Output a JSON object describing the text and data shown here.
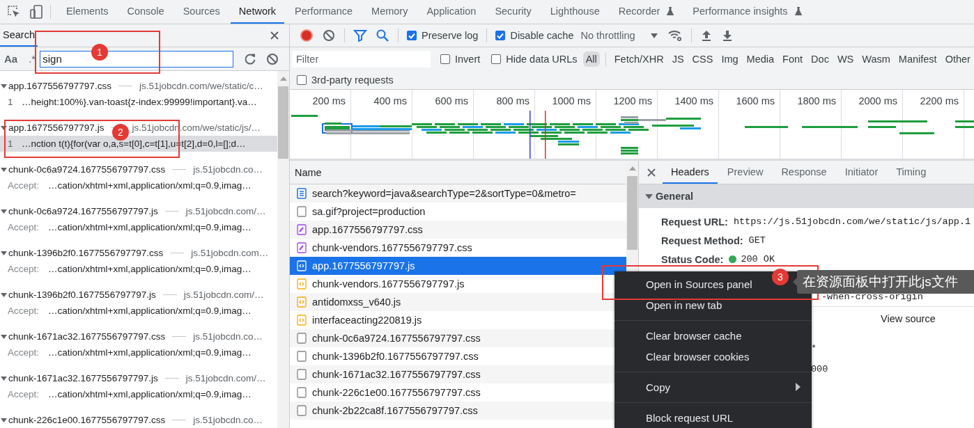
{
  "top_tabs": [
    {
      "label": "Elements",
      "selected": false,
      "experimental": false
    },
    {
      "label": "Console",
      "selected": false,
      "experimental": false
    },
    {
      "label": "Sources",
      "selected": false,
      "experimental": false
    },
    {
      "label": "Network",
      "selected": true,
      "experimental": false
    },
    {
      "label": "Performance",
      "selected": false,
      "experimental": false
    },
    {
      "label": "Memory",
      "selected": false,
      "experimental": false
    },
    {
      "label": "Application",
      "selected": false,
      "experimental": false
    },
    {
      "label": "Security",
      "selected": false,
      "experimental": false
    },
    {
      "label": "Lighthouse",
      "selected": false,
      "experimental": false
    },
    {
      "label": "Recorder",
      "selected": false,
      "experimental": true
    },
    {
      "label": "Performance insights",
      "selected": false,
      "experimental": true
    }
  ],
  "search_panel": {
    "title": "Search",
    "case_toggle": "Aa",
    "regex_toggle": ".*",
    "query": "sign",
    "results": [
      {
        "file": "app.1677556797797.css",
        "url": "js.51jobcdn.com/we/static/c…",
        "expanded": true,
        "matches": [
          {
            "prefix": "1",
            "kind": "line",
            "text": "…height:100%}.van-toast{z-index:99999!important}.va…",
            "selected": false
          }
        ]
      },
      {
        "file": "app.1677556797797.js",
        "url": "js.51jobcdn.com/we/static/js/…",
        "expanded": true,
        "matches": [
          {
            "prefix": "1",
            "kind": "line",
            "text": "…nction t(t){for(var o,a,s=t[0],c=t[1],u=t[2],d=0,l=[];d…",
            "selected": true
          }
        ]
      },
      {
        "file": "chunk-0c6a9724.1677556797797.css",
        "url": "js.51jobcdn.co…",
        "expanded": true,
        "matches": [
          {
            "prefix": "Accept:",
            "kind": "header",
            "text": "…cation/xhtml+xml,application/xml;q=0.9,imag…",
            "selected": false
          }
        ]
      },
      {
        "file": "chunk-0c6a9724.1677556797797.js",
        "url": "js.51jobcdn.com/…",
        "expanded": true,
        "matches": [
          {
            "prefix": "Accept:",
            "kind": "header",
            "text": "…cation/xhtml+xml,application/xml;q=0.9,imag…",
            "selected": false
          }
        ]
      },
      {
        "file": "chunk-1396b2f0.1677556797797.css",
        "url": "js.51jobcdn.com…",
        "expanded": true,
        "matches": [
          {
            "prefix": "Accept:",
            "kind": "header",
            "text": "…cation/xhtml+xml,application/xml;q=0.9,imag…",
            "selected": false
          }
        ]
      },
      {
        "file": "chunk-1396b2f0.1677556797797.js",
        "url": "js.51jobcdn.com/…",
        "expanded": true,
        "matches": [
          {
            "prefix": "Accept:",
            "kind": "header",
            "text": "…cation/xhtml+xml,application/xml;q=0.9,imag…",
            "selected": false
          }
        ]
      },
      {
        "file": "chunk-1671ac32.1677556797797.css",
        "url": "js.51jobcdn.co…",
        "expanded": true,
        "matches": [
          {
            "prefix": "Accept:",
            "kind": "header",
            "text": "…cation/xhtml+xml,application/xml;q=0.9,imag…",
            "selected": false
          }
        ]
      },
      {
        "file": "chunk-1671ac32.1677556797797.js",
        "url": "js.51jobcdn.com/…",
        "expanded": true,
        "matches": [
          {
            "prefix": "Accept:",
            "kind": "header",
            "text": "…cation/xhtml+xml,application/xml;q=0.9,imag…",
            "selected": false
          }
        ]
      },
      {
        "file": "chunk-226c1e00.1677556797797.css",
        "url": "js.51jobcdn.co…",
        "expanded": true
      }
    ]
  },
  "network_toolbar": {
    "preserve_log": {
      "label": "Preserve log",
      "checked": true
    },
    "disable_cache": {
      "label": "Disable cache",
      "checked": true
    },
    "throttling": "No throttling"
  },
  "filter_bar": {
    "placeholder": "Filter",
    "invert": {
      "label": "Invert",
      "checked": false
    },
    "hide_data_urls": {
      "label": "Hide data URLs",
      "checked": false
    },
    "types": [
      {
        "label": "All",
        "selected": true
      },
      {
        "label": "Fetch/XHR",
        "selected": false
      },
      {
        "label": "JS",
        "selected": false
      },
      {
        "label": "CSS",
        "selected": false
      },
      {
        "label": "Img",
        "selected": false
      },
      {
        "label": "Media",
        "selected": false
      },
      {
        "label": "Font",
        "selected": false
      },
      {
        "label": "Doc",
        "selected": false
      },
      {
        "label": "WS",
        "selected": false
      },
      {
        "label": "Wasm",
        "selected": false
      },
      {
        "label": "Manifest",
        "selected": false
      },
      {
        "label": "Other",
        "selected": false
      }
    ],
    "third_party": {
      "label": "3rd-party requests",
      "checked": false
    }
  },
  "overview": {
    "ticks": [
      "200 ms",
      "400 ms",
      "600 ms",
      "800 ms",
      "1000 ms",
      "1200 ms",
      "1400 ms",
      "1600 ms",
      "1800 ms",
      "2000 ms",
      "2200 ms"
    ]
  },
  "requests": {
    "column": "Name",
    "rows": [
      {
        "name": "search?keyword=java&searchType=2&sortType=0&metro=",
        "kind": "document",
        "selected": false
      },
      {
        "name": "sa.gif?project=production",
        "kind": "other",
        "selected": false
      },
      {
        "name": "app.1677556797797.css",
        "kind": "stylesheet",
        "selected": false
      },
      {
        "name": "chunk-vendors.1677556797797.css",
        "kind": "stylesheet",
        "selected": false
      },
      {
        "name": "app.1677556797797.js",
        "kind": "script",
        "selected": true
      },
      {
        "name": "chunk-vendors.1677556797797.js",
        "kind": "script",
        "selected": false
      },
      {
        "name": "antidomxss_v640.js",
        "kind": "script",
        "selected": false
      },
      {
        "name": "interfaceacting220819.js",
        "kind": "script",
        "selected": false
      },
      {
        "name": "chunk-0c6a9724.1677556797797.css",
        "kind": "other",
        "selected": false
      },
      {
        "name": "chunk-1396b2f0.1677556797797.css",
        "kind": "other",
        "selected": false
      },
      {
        "name": "chunk-1671ac32.1677556797797.css",
        "kind": "other",
        "selected": false
      },
      {
        "name": "chunk-226c1e00.1677556797797.css",
        "kind": "other",
        "selected": false
      },
      {
        "name": "chunk-2b22ca8f.1677556797797.css",
        "kind": "other",
        "selected": false
      }
    ]
  },
  "details": {
    "tabs": [
      {
        "label": "Headers",
        "selected": true
      },
      {
        "label": "Preview",
        "selected": false
      },
      {
        "label": "Response",
        "selected": false
      },
      {
        "label": "Initiator",
        "selected": false
      },
      {
        "label": "Timing",
        "selected": false
      }
    ],
    "section": {
      "title": "General",
      "expanded": true,
      "rows": [
        {
          "label": "Request URL:",
          "value": "https://js.51jobcdn.com/we/static/js/app.1"
        },
        {
          "label": "Request Method:",
          "value": "GET"
        },
        {
          "label": "Status Code:",
          "value": "200 OK",
          "color": "#34a853"
        }
      ]
    },
    "partly_hidden": [
      "-when-cross-origin"
    ],
    "view_source": "View source",
    "fragments": [
      "*",
      "000"
    ]
  },
  "context_menu": {
    "groups": [
      [
        {
          "label": "Open in Sources panel",
          "submenu": false
        },
        {
          "label": "Open in new tab",
          "submenu": false
        }
      ],
      [
        {
          "label": "Clear browser cache",
          "submenu": false
        },
        {
          "label": "Clear browser cookies",
          "submenu": false
        }
      ],
      [
        {
          "label": "Copy",
          "submenu": true
        }
      ],
      [
        {
          "label": "Block request URL",
          "submenu": false
        }
      ]
    ]
  },
  "annotations": [
    {
      "number": "1"
    },
    {
      "number": "2"
    },
    {
      "number": "3",
      "note": "在资源面板中打开此js文件"
    }
  ]
}
